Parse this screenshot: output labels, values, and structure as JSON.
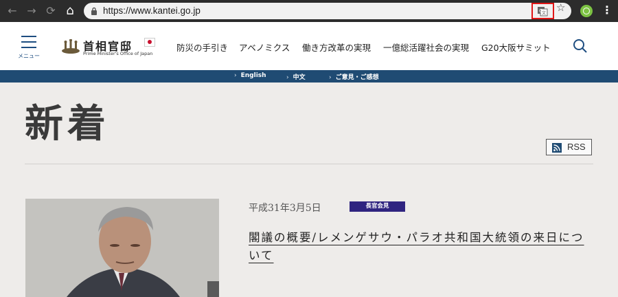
{
  "browser": {
    "url": "https://www.kantei.go.jp",
    "buttons": {
      "back_icon": "arrow-left-icon",
      "forward_icon": "arrow-right-icon",
      "reload_icon": "reload-icon",
      "home_icon": "home-icon"
    },
    "back_glyph": "←",
    "forward_glyph": "→",
    "reload_glyph": "⟳",
    "home_glyph": "⌂",
    "star_glyph": "☆",
    "menu_glyph": "⋮",
    "translate_highlight_color": "#e01515"
  },
  "header": {
    "menu_label": "メニュー",
    "logo_title": "首相官邸",
    "logo_subtitle": "Prime Minister's Office of Japan",
    "nav": [
      {
        "label": "防災の手引き"
      },
      {
        "label": "アベノミクス"
      },
      {
        "label": "働き方改革の実現"
      },
      {
        "label": "一億総活躍社会の実現"
      },
      {
        "label": "G20大阪サミット"
      }
    ]
  },
  "langbar": {
    "links": [
      {
        "label": "English"
      },
      {
        "label": "中文"
      },
      {
        "label": "ご意見・ご感想"
      }
    ],
    "chevron": "›"
  },
  "main": {
    "title": "新着",
    "rss_label": "RSS",
    "news": {
      "date": "平成31年3月5日",
      "badge": "長官会見",
      "headline": "閣議の概要/レメンゲサウ・パラオ共和国大統領の来日について"
    }
  },
  "colors": {
    "brand_navy": "#1f4b73",
    "badge_purple": "#2f2480",
    "background": "#eeecea"
  }
}
